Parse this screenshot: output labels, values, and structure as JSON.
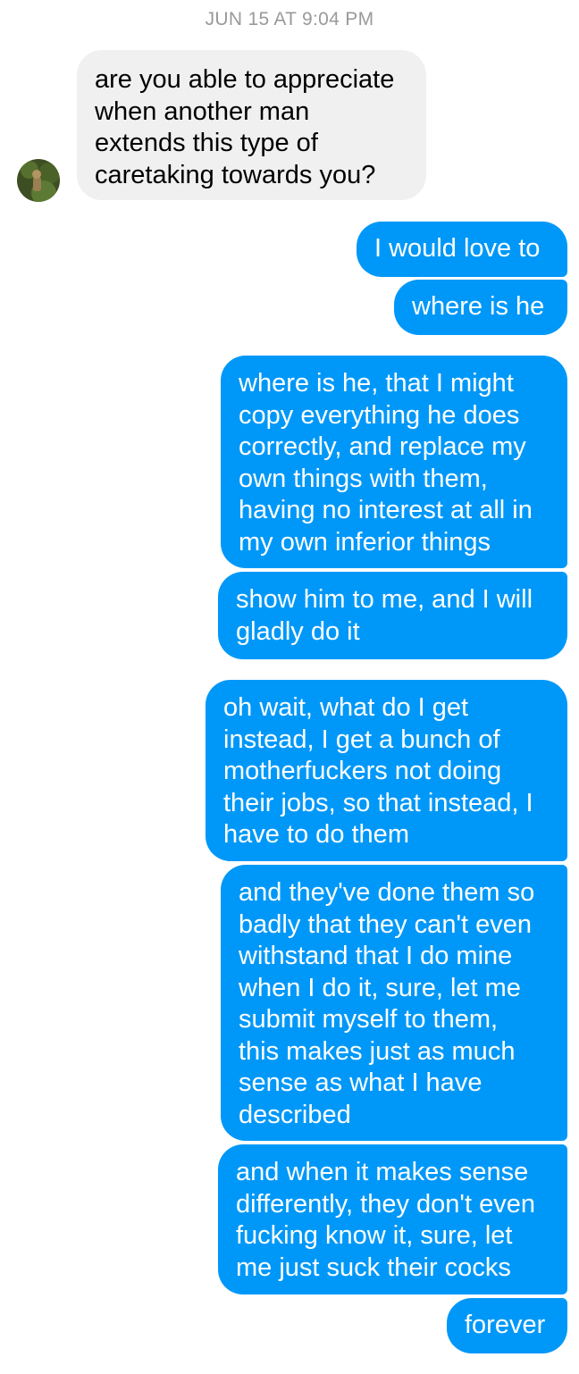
{
  "conversation": {
    "timestamp": "JUN 15 AT 9:04 PM",
    "colors": {
      "outgoing_bubble": "#0098f8",
      "incoming_bubble": "#f1f0f0",
      "timestamp_text": "#9a9a9a"
    },
    "messages": [
      {
        "direction": "incoming",
        "text": "are you able to appreciate\nwhen another man\nextends this type of\ncaretaking towards you?"
      },
      {
        "direction": "outgoing",
        "text": "I would love to"
      },
      {
        "direction": "outgoing",
        "text": "where is he"
      },
      {
        "direction": "outgoing",
        "text": "where is he, that I might\ncopy everything he does\ncorrectly, and replace my\nown things with them,\nhaving no interest at all in\nmy own inferior things"
      },
      {
        "direction": "outgoing",
        "text": "show him to me, and I will\ngladly do it"
      },
      {
        "direction": "outgoing",
        "text": "oh wait, what do I get\ninstead, I get a bunch of\nmotherfuckers not doing\ntheir jobs, so that instead, I\nhave to do them"
      },
      {
        "direction": "outgoing",
        "text": "and they've done them so\nbadly that they can't even\nwithstand that I do mine\nwhen I do it, sure, let me\nsubmit myself to them,\nthis makes just as much\nsense as what I have\ndescribed"
      },
      {
        "direction": "outgoing",
        "text": "and when it makes sense\ndifferently, they don't even\nfucking know it, sure, let\nme just suck their cocks"
      },
      {
        "direction": "outgoing",
        "text": "forever"
      }
    ]
  }
}
